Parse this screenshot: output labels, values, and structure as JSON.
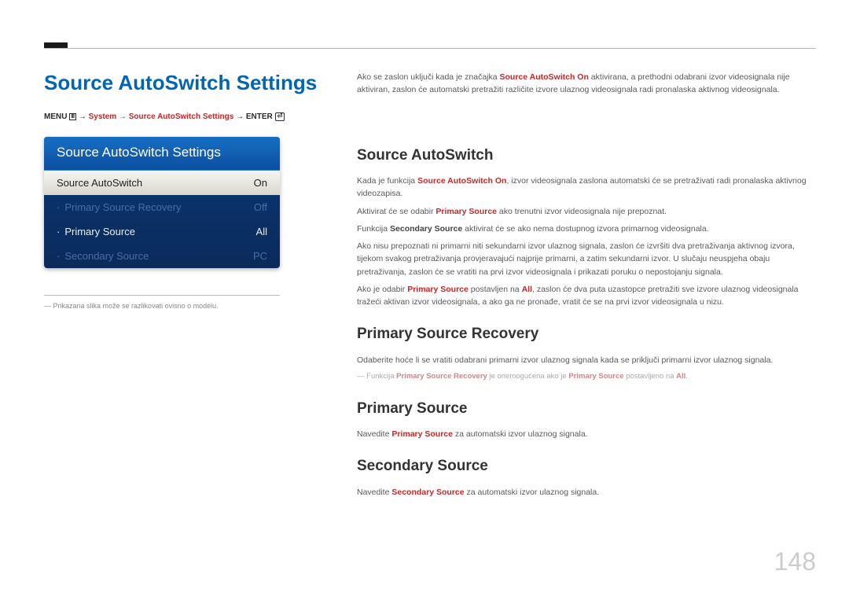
{
  "page_number": "148",
  "main_title": "Source AutoSwitch Settings",
  "breadcrumb": {
    "menu": "MENU",
    "path": "System → Source AutoSwitch Settings",
    "enter": "ENTER"
  },
  "panel": {
    "header": "Source AutoSwitch Settings",
    "rows": [
      {
        "label": "Source AutoSwitch",
        "value": "On",
        "state": "selected"
      },
      {
        "label": "Primary Source Recovery",
        "value": "Off",
        "state": "disabled"
      },
      {
        "label": "Primary Source",
        "value": "All",
        "state": "enabled"
      },
      {
        "label": "Secondary Source",
        "value": "PC",
        "state": "disabled"
      }
    ]
  },
  "footnote": "Prikazana slika može se razlikovati ovisno o modelu.",
  "intro": {
    "p1a": "Ako se zaslon uključi kada je značajka ",
    "p1b": "Source AutoSwitch On",
    "p1c": " aktivirana, a prethodni odabrani izvor videosignala nije aktiviran, zaslon će automatski pretražiti različite izvore ulaznog videosignala radi pronalaska aktivnog videosignala."
  },
  "sections": {
    "s1": {
      "title": "Source AutoSwitch",
      "p1a": "Kada je funkcija ",
      "p1b": "Source AutoSwitch On",
      "p1c": ", izvor videosignala zaslona automatski će se pretraživati radi pronalaska aktivnog videozapisa.",
      "p2a": "Aktivirat će se odabir ",
      "p2b": "Primary Source",
      "p2c": " ako trenutni izvor videosignala nije prepoznat.",
      "p3a": "Funkcija ",
      "p3b": "Secondary Source",
      "p3c": " aktivirat će se ako nema dostupnog izvora primarnog videosignala.",
      "p4": "Ako nisu prepoznati ni primarni niti sekundarni izvor ulaznog signala, zaslon će izvršiti dva pretraživanja aktivnog izvora, tijekom svakog pretraživanja provjeravajući najprije primarni, a zatim sekundarni izvor. U slučaju neuspjeha obaju pretraživanja, zaslon će se vratiti na prvi izvor videosignala i prikazati poruku o nepostojanju signala.",
      "p5a": "Ako je odabir ",
      "p5b": "Primary Source",
      "p5c": " postavljen na ",
      "p5d": "All",
      "p5e": ", zaslon će dva puta uzastopce pretražiti sve izvore ulaznog videosignala tražeći aktivan izvor videosignala, a ako ga ne pronađe, vratit će se na prvi izvor videosignala u nizu."
    },
    "s2": {
      "title": "Primary Source Recovery",
      "p1": "Odaberite hoće li se vratiti odabrani primarni izvor ulaznog signala kada se priključi primarni izvor ulaznog signala.",
      "note_a": "Funkcija ",
      "note_b": "Primary Source Recovery",
      "note_c": " je onemogućena ako je ",
      "note_d": "Primary Source",
      "note_e": " postavljeno na ",
      "note_f": "All",
      "note_g": "."
    },
    "s3": {
      "title": "Primary Source",
      "p1a": "Navedite ",
      "p1b": "Primary Source",
      "p1c": " za automatski izvor ulaznog signala."
    },
    "s4": {
      "title": "Secondary Source",
      "p1a": "Navedite ",
      "p1b": "Secondary Source",
      "p1c": " za automatski izvor ulaznog signala."
    }
  }
}
